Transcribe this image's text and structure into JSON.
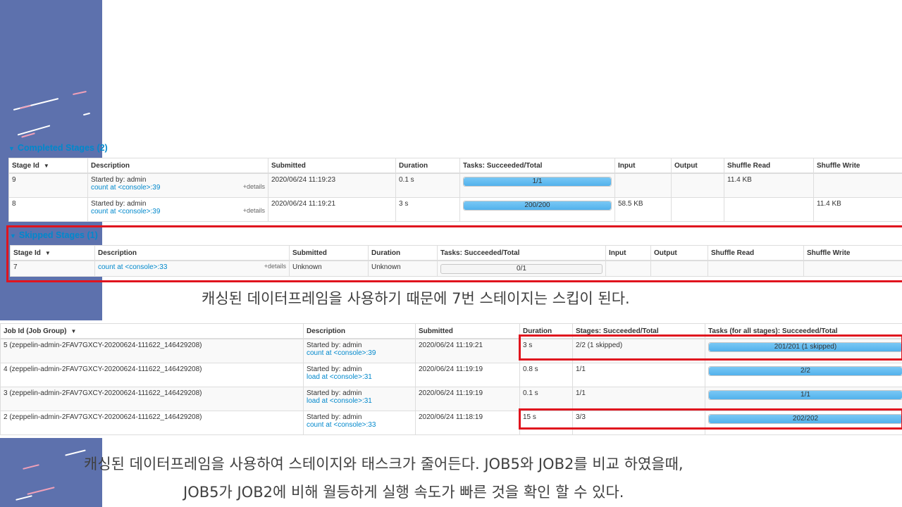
{
  "completed": {
    "title": "Completed Stages (2)",
    "headers": [
      "Stage Id",
      "Description",
      "Submitted",
      "Duration",
      "Tasks: Succeeded/Total",
      "Input",
      "Output",
      "Shuffle Read",
      "Shuffle Write"
    ],
    "rows": [
      {
        "id": "9",
        "started": "Started by: admin",
        "link": "count at <console>:39",
        "details": "+details",
        "submitted": "2020/06/24 11:19:23",
        "duration": "0.1 s",
        "tasks": "1/1",
        "progress": 1.0,
        "input": "",
        "output": "",
        "shuffle_read": "11.4 KB",
        "shuffle_write": ""
      },
      {
        "id": "8",
        "started": "Started by: admin",
        "link": "count at <console>:39",
        "details": "+details",
        "submitted": "2020/06/24 11:19:21",
        "duration": "3 s",
        "tasks": "200/200",
        "progress": 1.0,
        "input": "58.5 KB",
        "output": "",
        "shuffle_read": "",
        "shuffle_write": "11.4 KB"
      }
    ]
  },
  "skipped": {
    "title": "Skipped Stages (1)",
    "headers": [
      "Stage Id",
      "Description",
      "Submitted",
      "Duration",
      "Tasks: Succeeded/Total",
      "Input",
      "Output",
      "Shuffle Read",
      "Shuffle Write"
    ],
    "rows": [
      {
        "id": "7",
        "link": "count at <console>:33",
        "details": "+details",
        "submitted": "Unknown",
        "duration": "Unknown",
        "tasks": "0/1",
        "progress": 0.0
      }
    ]
  },
  "caption1": "캐싱된 데이터프레임을 사용하기 때문에 7번 스테이지는 스킵이 된다.",
  "jobs": {
    "headers": [
      "Job Id (Job Group)",
      "Description",
      "Submitted",
      "Duration",
      "Stages: Succeeded/Total",
      "Tasks (for all stages): Succeeded/Total"
    ],
    "rows": [
      {
        "id": "5 (zeppelin-admin-2FAV7GXCY-20200624-111622_146429208)",
        "started": "Started by: admin",
        "link": "count at <console>:39",
        "submitted": "2020/06/24 11:19:21",
        "duration": "3 s",
        "stages": "2/2 (1 skipped)",
        "tasks": "201/201 (1 skipped)",
        "progress": 1.0
      },
      {
        "id": "4 (zeppelin-admin-2FAV7GXCY-20200624-111622_146429208)",
        "started": "Started by: admin",
        "link": "load at <console>:31",
        "submitted": "2020/06/24 11:19:19",
        "duration": "0.8 s",
        "stages": "1/1",
        "tasks": "2/2",
        "progress": 1.0
      },
      {
        "id": "3 (zeppelin-admin-2FAV7GXCY-20200624-111622_146429208)",
        "started": "Started by: admin",
        "link": "load at <console>:31",
        "submitted": "2020/06/24 11:19:19",
        "duration": "0.1 s",
        "stages": "1/1",
        "tasks": "1/1",
        "progress": 1.0
      },
      {
        "id": "2 (zeppelin-admin-2FAV7GXCY-20200624-111622_146429208)",
        "started": "Started by: admin",
        "link": "count at <console>:33",
        "submitted": "2020/06/24 11:18:19",
        "duration": "15 s",
        "stages": "3/3",
        "tasks": "202/202",
        "progress": 1.0
      }
    ]
  },
  "caption2_line1": "캐싱된 데이터프레임을 사용하여 스테이지와 태스크가 줄어든다. JOB5와 JOB2를 비교 하였을때,",
  "caption2_line2": "JOB5가 JOB2에 비해 월등하게 실행 속도가 빠른 것을 확인 할 수 있다.",
  "colors": {
    "sidebar": "#5d71ad",
    "link": "#0088cc",
    "highlight": "#e0141e",
    "progress": "#52b1ec"
  }
}
